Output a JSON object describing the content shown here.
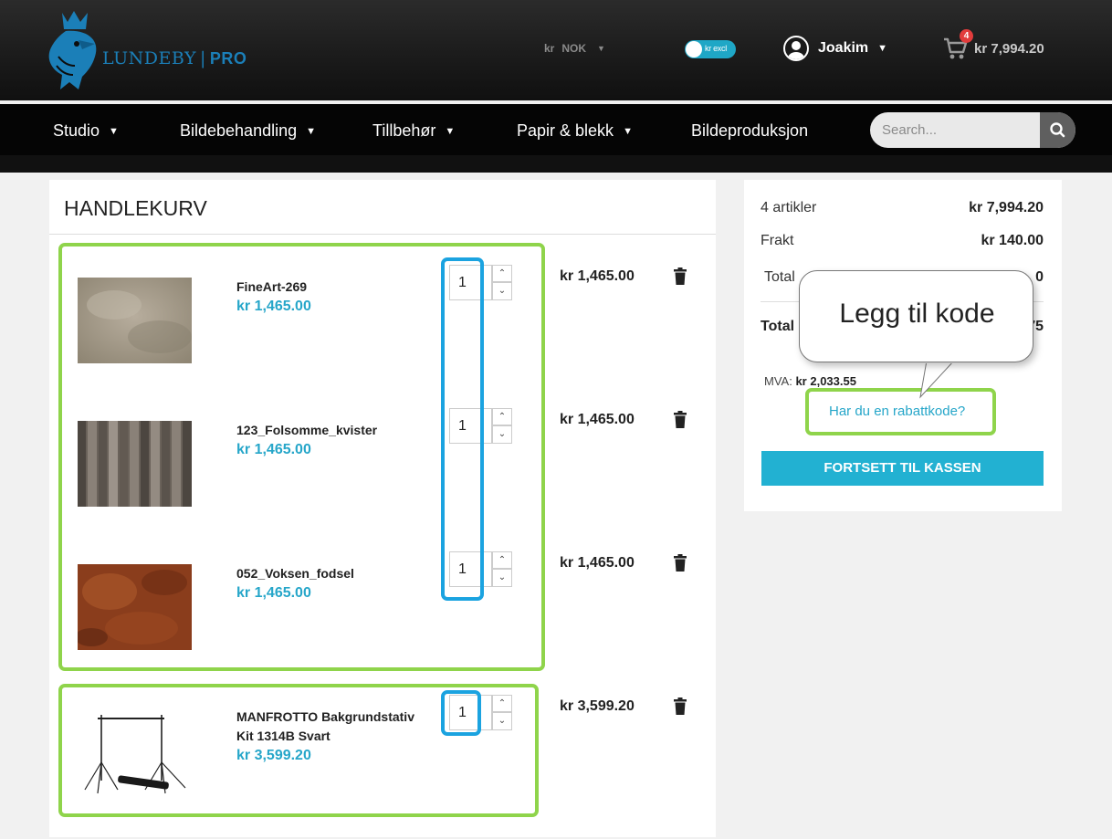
{
  "header": {
    "brand_name": "LUNDEBY",
    "brand_suffix": "PRO",
    "currency_symbol": "kr",
    "currency_code": "NOK",
    "vat_toggle_label": "kr excl",
    "user_name": "Joakim",
    "cart_count": "4",
    "cart_total": "kr 7,994.20"
  },
  "nav": {
    "items": [
      {
        "label": "Studio",
        "has_menu": true
      },
      {
        "label": "Bildebehandling",
        "has_menu": true
      },
      {
        "label": "Tillbehør",
        "has_menu": true
      },
      {
        "label": "Papir & blekk",
        "has_menu": true
      },
      {
        "label": "Bildeproduksjon",
        "has_menu": false
      }
    ],
    "search_placeholder": "Search..."
  },
  "cart": {
    "title": "HANDLEKURV",
    "items": [
      {
        "name": "FineArt-269",
        "price": "kr 1,465.00",
        "qty": "1",
        "total": "kr 1,465.00",
        "thumb": "mottled grey-beige backdrop"
      },
      {
        "name": "123_Folsomme_kvister",
        "price": "kr 1,465.00",
        "qty": "1",
        "total": "kr 1,465.00",
        "thumb": "weathered wood planks backdrop"
      },
      {
        "name": "052_Voksen_fodsel",
        "price": "kr 1,465.00",
        "qty": "1",
        "total": "kr 1,465.00",
        "thumb": "rust orange textured backdrop"
      },
      {
        "name": "MANFROTTO Bakgrundstativ Kit 1314B Svart",
        "price": "kr 3,599.20",
        "qty": "1",
        "total": "kr 3,599.20",
        "thumb": "background stand kit"
      }
    ]
  },
  "summary": {
    "articles_label": "4 artikler",
    "articles_value": "kr 7,994.20",
    "shipping_label": "Frakt",
    "shipping_value": "kr 140.00",
    "total_tax_label": "Total",
    "total_tax_value_fragment": "0",
    "total_label": "Total",
    "total_value_fragment": "75",
    "mva_label": "MVA:",
    "mva_value": "kr 2,033.55",
    "promo_link": "Har du en rabattkode?",
    "checkout_button": "FORTSETT TIL KASSEN"
  },
  "annotation": {
    "callout_text": "Legg til kode"
  },
  "colors": {
    "accent": "#26a6c9",
    "checkout": "#22b1d2",
    "highlight_green": "#8fd44b",
    "highlight_blue": "#1ba3e0",
    "badge": "#e23c3c"
  }
}
